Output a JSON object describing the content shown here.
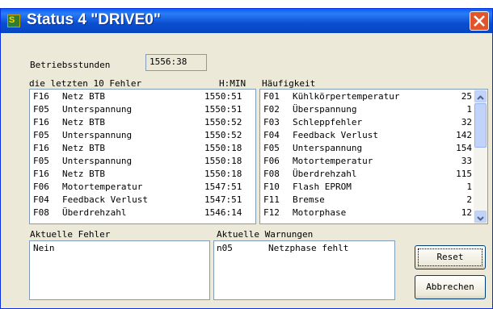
{
  "window": {
    "title": "Status 4 \"DRIVE0\"",
    "icon": "app-status-icon"
  },
  "operating_hours": {
    "label": "Betriebsstunden",
    "value": "1556:38"
  },
  "errors": {
    "header": "die letzten 10 Fehler",
    "time_header": "H:MIN",
    "rows": [
      {
        "code": "F16",
        "text": "Netz BTB",
        "time": "1550:51"
      },
      {
        "code": "F05",
        "text": "Unterspannung",
        "time": "1550:51"
      },
      {
        "code": "F16",
        "text": "Netz BTB",
        "time": "1550:52"
      },
      {
        "code": "F05",
        "text": "Unterspannung",
        "time": "1550:52"
      },
      {
        "code": "F16",
        "text": "Netz BTB",
        "time": "1550:18"
      },
      {
        "code": "F05",
        "text": "Unterspannung",
        "time": "1550:18"
      },
      {
        "code": "F16",
        "text": "Netz BTB",
        "time": "1550:18"
      },
      {
        "code": "F06",
        "text": "Motortemperatur",
        "time": "1547:51"
      },
      {
        "code": "F04",
        "text": "Feedback Verlust",
        "time": "1547:51"
      },
      {
        "code": "F08",
        "text": "Überdrehzahl",
        "time": "1546:14"
      }
    ]
  },
  "frequency": {
    "header": "Häufigkeit",
    "rows": [
      {
        "code": "F01",
        "text": "Kühlkörpertemperatur",
        "count": "25"
      },
      {
        "code": "F02",
        "text": "Überspannung",
        "count": "1"
      },
      {
        "code": "F03",
        "text": "Schleppfehler",
        "count": "32"
      },
      {
        "code": "F04",
        "text": "Feedback Verlust",
        "count": "142"
      },
      {
        "code": "F05",
        "text": "Unterspannung",
        "count": "154"
      },
      {
        "code": "F06",
        "text": "Motortemperatur",
        "count": "33"
      },
      {
        "code": "F08",
        "text": "Überdrehzahl",
        "count": "115"
      },
      {
        "code": "F10",
        "text": "Flash EPROM",
        "count": "1"
      },
      {
        "code": "F11",
        "text": "Bremse",
        "count": "2"
      },
      {
        "code": "F12",
        "text": "Motorphase",
        "count": "12"
      }
    ]
  },
  "current_errors": {
    "label": "Aktuelle Fehler",
    "content": "Nein"
  },
  "current_warnings": {
    "label": "Aktuelle Warnungen",
    "code": "n05",
    "text": "Netzphase fehlt"
  },
  "buttons": {
    "reset": "Reset",
    "cancel": "Abbrechen"
  },
  "colors": {
    "titlebar": "#0a5ef3",
    "close": "#e2552b",
    "dialog": "#ece9d8"
  }
}
